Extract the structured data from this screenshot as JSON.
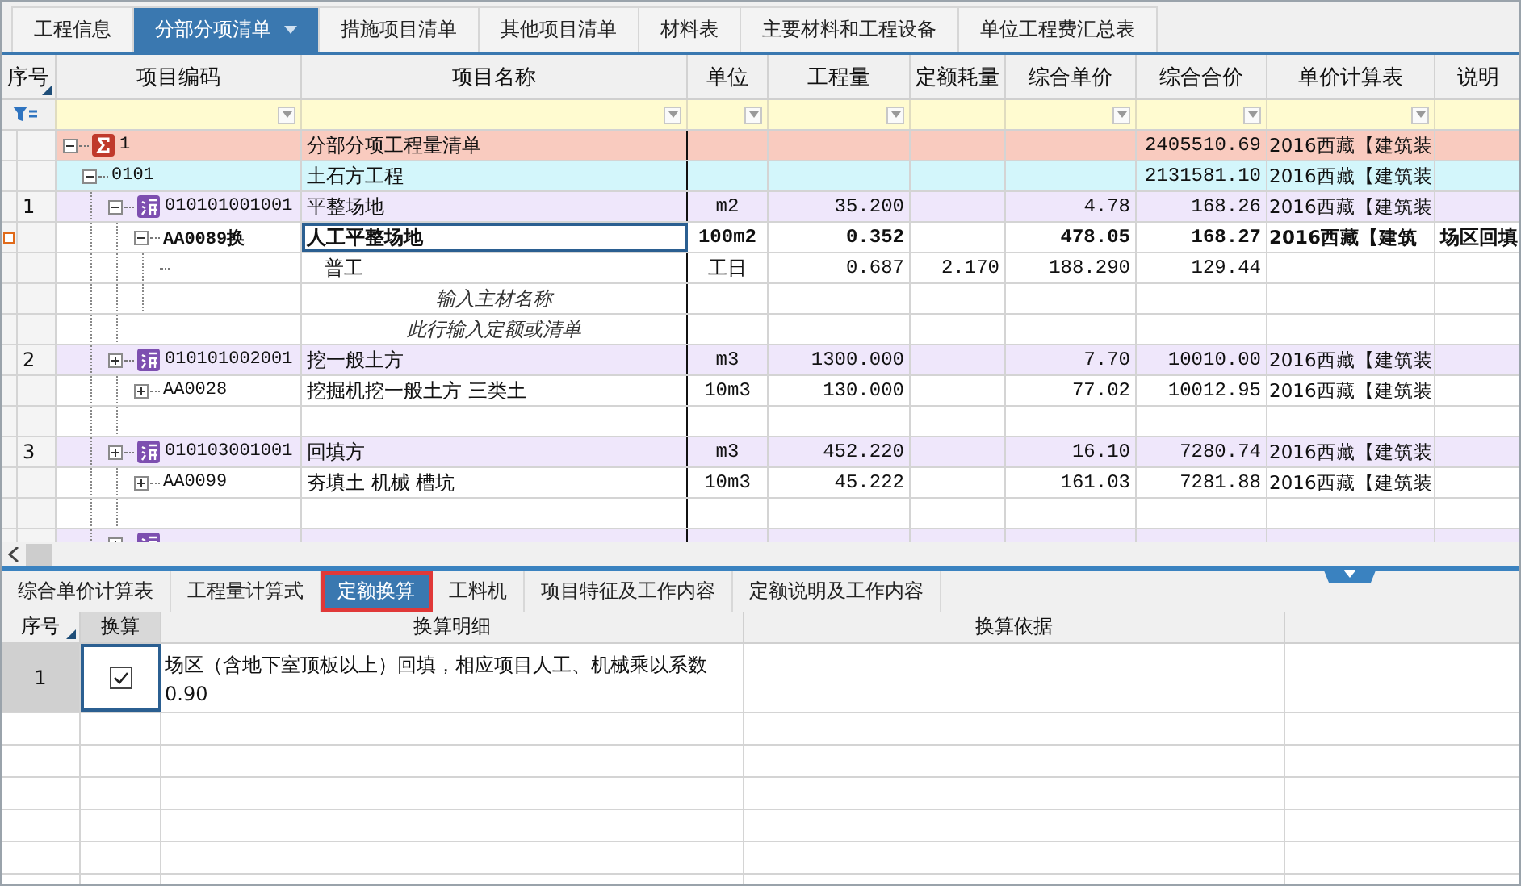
{
  "top_tabs": [
    {
      "label": "工程信息",
      "selected": false
    },
    {
      "label": "分部分项清单",
      "selected": true,
      "dropdown": true
    },
    {
      "label": "措施项目清单",
      "selected": false
    },
    {
      "label": "其他项目清单",
      "selected": false
    },
    {
      "label": "材料表",
      "selected": false
    },
    {
      "label": "主要材料和工程设备",
      "selected": false
    },
    {
      "label": "单位工程费汇总表",
      "selected": false
    }
  ],
  "grid": {
    "columns": [
      {
        "label": "序号",
        "filter": false
      },
      {
        "label": "项目编码",
        "filter": true
      },
      {
        "label": "项目名称",
        "filter": true
      },
      {
        "label": "单位",
        "filter": true
      },
      {
        "label": "工程量",
        "filter": true
      },
      {
        "label": "定额耗量",
        "filter": false
      },
      {
        "label": "综合单价",
        "filter": true
      },
      {
        "label": "综合合价",
        "filter": true
      },
      {
        "label": "单价计算表",
        "filter": true
      },
      {
        "label": "说明",
        "filter": false
      }
    ],
    "rows": [
      {
        "kind": "section",
        "expanded": true,
        "selected": false,
        "code": "1",
        "name": "分部分项工程量清单",
        "total": "2405510.69",
        "calc_table": "2016西藏【建筑装",
        "children": [
          {
            "kind": "subsection",
            "expanded": true,
            "selected": false,
            "code": "0101",
            "name": "土石方工程",
            "total": "2131581.10",
            "calc_table": "2016西藏【建筑装",
            "children": [
              {
                "kind": "item",
                "expanded": true,
                "selected": false,
                "no": "1",
                "code": "010101001001",
                "name": "平整场地",
                "unit": "m2",
                "qty": "35.200",
                "unit_price": "4.78",
                "total": "168.26",
                "calc_table": "2016西藏【建筑装",
                "children": [
                  {
                    "kind": "quota",
                    "expanded": true,
                    "selected": true,
                    "code": "AA0089换",
                    "name": "人工平整场地",
                    "unit": "100m2",
                    "qty": "0.352",
                    "unit_price": "478.05",
                    "total": "168.27",
                    "calc_table": "2016西藏【建筑",
                    "note": "场区回填",
                    "children": [
                      {
                        "kind": "resource",
                        "selected": false,
                        "name": "普工",
                        "unit": "工日",
                        "qty": "0.687",
                        "quota_qty": "2.170",
                        "unit_price": "188.290",
                        "total": "129.44"
                      },
                      {
                        "kind": "hint",
                        "selected": false,
                        "name": "输入主材名称"
                      }
                    ]
                  },
                  {
                    "kind": "hint",
                    "selected": false,
                    "name": "此行输入定额或清单"
                  }
                ]
              },
              {
                "kind": "item",
                "expanded": false,
                "selected": false,
                "no": "2",
                "code": "010101002001",
                "name": "挖一般土方",
                "unit": "m3",
                "qty": "1300.000",
                "unit_price": "7.70",
                "total": "10010.00",
                "calc_table": "2016西藏【建筑装",
                "children": [
                  {
                    "kind": "quota",
                    "expanded": false,
                    "selected": false,
                    "code": "AA0028",
                    "name": "挖掘机挖一般土方 三类土",
                    "unit": "10m3",
                    "qty": "130.000",
                    "unit_price": "77.02",
                    "total": "10012.95",
                    "calc_table": "2016西藏【建筑装"
                  },
                  {
                    "kind": "blank",
                    "selected": false
                  }
                ]
              },
              {
                "kind": "item",
                "expanded": false,
                "selected": false,
                "no": "3",
                "code": "010103001001",
                "name": "回填方",
                "unit": "m3",
                "qty": "452.220",
                "unit_price": "16.10",
                "total": "7280.74",
                "calc_table": "2016西藏【建筑装",
                "children": [
                  {
                    "kind": "quota",
                    "expanded": false,
                    "selected": false,
                    "code": "AA0099",
                    "name": "夯填土 机械 槽坑",
                    "unit": "10m3",
                    "qty": "45.222",
                    "unit_price": "161.03",
                    "total": "7281.88",
                    "calc_table": "2016西藏【建筑装"
                  },
                  {
                    "kind": "blank",
                    "selected": false
                  }
                ]
              },
              {
                "kind": "item",
                "expanded": false,
                "selected": false
              }
            ]
          }
        ]
      }
    ]
  },
  "bottom_tabs": [
    {
      "label": "综合单价计算表",
      "selected": false
    },
    {
      "label": "工程量计算式",
      "selected": false
    },
    {
      "label": "定额换算",
      "selected": true
    },
    {
      "label": "工料机",
      "selected": false
    },
    {
      "label": "项目特征及工作内容",
      "selected": false
    },
    {
      "label": "定额说明及工作内容",
      "selected": false
    }
  ],
  "conversion": {
    "columns": [
      "序号",
      "换算",
      "换算明细",
      "换算依据"
    ],
    "rows": [
      {
        "no": "1",
        "checked": true,
        "detail": "场区（含地下室顶板以上）回填，相应项目人工、机械乘以系数0.90"
      }
    ]
  }
}
